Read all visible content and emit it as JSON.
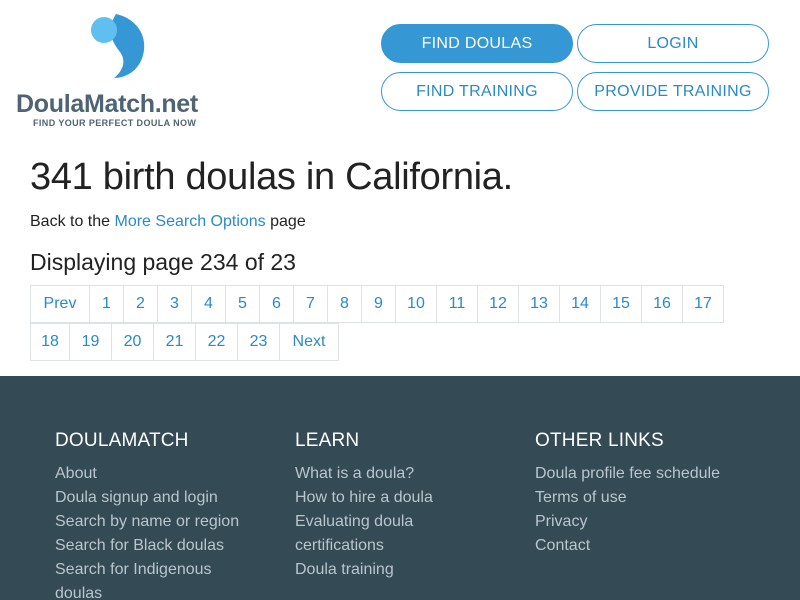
{
  "logo": {
    "name_main": "DoulaMatch",
    "name_ext": ".net",
    "tagline": "FIND YOUR PERFECT DOULA NOW"
  },
  "nav": {
    "find_doulas": "FIND DOULAS",
    "login": "LOGIN",
    "find_training": "FIND TRAINING",
    "provide_training": "PROVIDE TRAINING"
  },
  "main": {
    "title": "341 birth doulas in California.",
    "back_prefix": "Back to the ",
    "back_link": "More Search Options",
    "back_suffix": " page",
    "displaying": "Displaying page 234 of 23"
  },
  "pagination": {
    "prev": "Prev",
    "next": "Next",
    "row1": [
      "1",
      "2",
      "3",
      "4",
      "5",
      "6",
      "7",
      "8",
      "9",
      "10",
      "11",
      "12",
      "13",
      "14",
      "15",
      "16",
      "17"
    ],
    "row2": [
      "18",
      "19",
      "20",
      "21",
      "22",
      "23"
    ]
  },
  "footer": {
    "col1": {
      "heading": "DOULAMATCH",
      "links": [
        "About",
        "Doula signup and login",
        "Search by name or region",
        "Search for Black doulas",
        "Search for Indigenous",
        "doulas"
      ]
    },
    "col2": {
      "heading": "LEARN",
      "links": [
        "What is a doula?",
        "How to hire a doula",
        "Evaluating doula",
        "certifications",
        "Doula training"
      ]
    },
    "col3": {
      "heading": "OTHER LINKS",
      "links": [
        "Doula profile fee schedule",
        "Terms of use",
        "Privacy",
        "Contact"
      ]
    }
  },
  "colors": {
    "accent": "#3597d3",
    "footer_bg": "#344a55",
    "footer_link": "#b9c6cd"
  }
}
